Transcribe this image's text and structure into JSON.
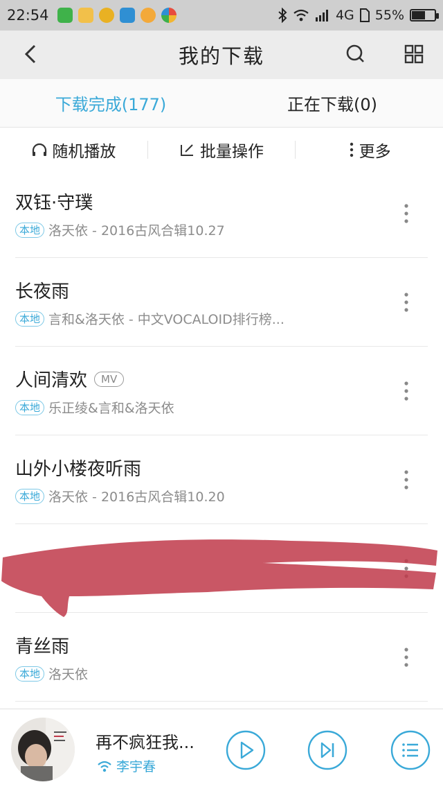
{
  "status_bar": {
    "time": "22:54",
    "network": "4G",
    "battery_percent": "55%",
    "battery_level": 0.55
  },
  "header": {
    "title": "我的下载"
  },
  "tabs": [
    {
      "label": "下载完成(177)",
      "active": true
    },
    {
      "label": "正在下载(0)",
      "active": false
    }
  ],
  "actions": {
    "shuffle_label": "随机播放",
    "batch_label": "批量操作",
    "more_label": "更多"
  },
  "songs": [
    {
      "title": "双钰·守璞",
      "badge": "本地",
      "subtitle": "洛天依 - 2016古风合辑10.27",
      "mv": ""
    },
    {
      "title": "长夜雨",
      "badge": "本地",
      "subtitle": "言和&洛天依 - 中文VOCALOID排行榜...",
      "mv": ""
    },
    {
      "title": "人间清欢",
      "badge": "本地",
      "subtitle": "乐正绫&言和&洛天依",
      "mv": "MV"
    },
    {
      "title": "山外小楼夜听雨",
      "badge": "本地",
      "subtitle": "洛天依 - 2016古风合辑10.20",
      "mv": ""
    },
    {
      "title": "",
      "badge": "",
      "subtitle": "",
      "mv": ""
    },
    {
      "title": "青丝雨",
      "badge": "本地",
      "subtitle": "洛天依",
      "mv": ""
    }
  ],
  "player": {
    "title": "再不疯狂我...",
    "artist": "李宇春"
  },
  "colors": {
    "accent": "#3aa9d8",
    "scribble": "#c0394a"
  }
}
